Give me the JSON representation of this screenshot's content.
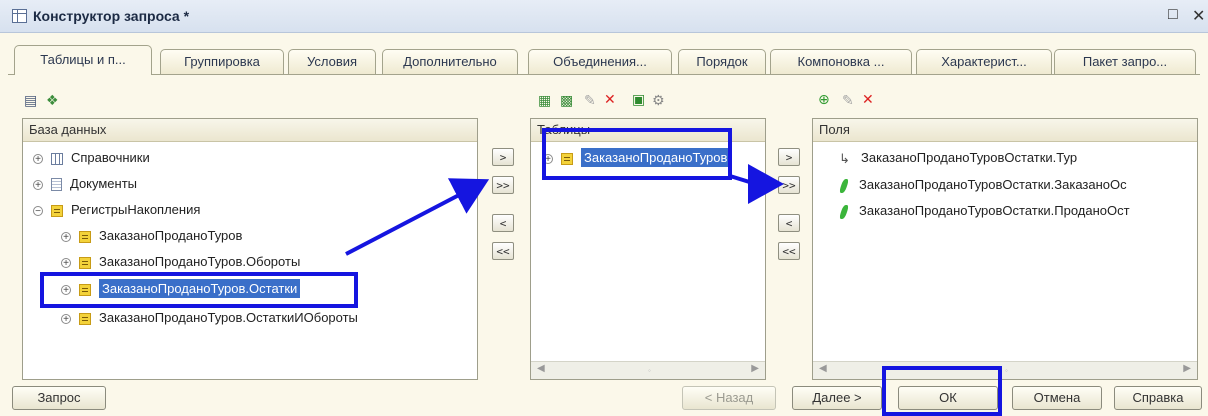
{
  "window": {
    "title": "Конструктор запроса *",
    "maximize_glyph": "□",
    "close_glyph": "✕"
  },
  "tabs": [
    {
      "label": "Таблицы и п...",
      "active": true
    },
    {
      "label": "Группировка"
    },
    {
      "label": "Условия"
    },
    {
      "label": "Дополнительно"
    },
    {
      "label": "Объединения..."
    },
    {
      "label": "Порядок"
    },
    {
      "label": "Компоновка ..."
    },
    {
      "label": "Характерист..."
    },
    {
      "label": "Пакет запро..."
    }
  ],
  "database_panel": {
    "header": "База данных",
    "items": [
      {
        "label": "Справочники",
        "icon": "catalog-icon",
        "expander": "⊕"
      },
      {
        "label": "Документы",
        "icon": "document-icon",
        "expander": "⊕"
      },
      {
        "label": "РегистрыНакопления",
        "icon": "register-icon",
        "expander": "⊖"
      },
      {
        "label": "ЗаказаноПроданоТуров",
        "icon": "register-icon",
        "expander": "⊕"
      },
      {
        "label": "ЗаказаноПроданоТуров.Обороты",
        "icon": "register-icon",
        "expander": "⊕"
      },
      {
        "label": "ЗаказаноПроданоТуров.Остатки",
        "icon": "register-icon",
        "expander": "⊕",
        "selected": true
      },
      {
        "label": "ЗаказаноПроданоТуров.ОстаткиИОбороты",
        "icon": "register-icon",
        "expander": "⊕"
      }
    ]
  },
  "tables_panel": {
    "header": "Таблицы",
    "items": [
      {
        "label": "ЗаказаноПроданоТуров",
        "icon": "register-icon",
        "expander": "⊕",
        "selected": true
      }
    ]
  },
  "fields_panel": {
    "header": "Поля",
    "items": [
      {
        "label": "ЗаказаноПроданоТуровОстатки.Тур",
        "icon": "hierarchy-icon"
      },
      {
        "label": "ЗаказаноПроданоТуровОстатки.ЗаказаноОс",
        "icon": "field-icon"
      },
      {
        "label": "ЗаказаноПроданоТуровОстатки.ПроданоОст",
        "icon": "field-icon"
      }
    ]
  },
  "transfer_buttons": {
    "add": ">",
    "add_all": ">>",
    "remove": "<",
    "remove_all": "<<"
  },
  "buttons": {
    "query": "Запрос",
    "back": "< Назад",
    "next": "Далее >",
    "ok": "ОК",
    "cancel": "Отмена",
    "help": "Справка"
  },
  "colors": {
    "annotation": "#1515e0",
    "selection": "#3a6fc9",
    "window_bg": "#fbf8ea"
  }
}
